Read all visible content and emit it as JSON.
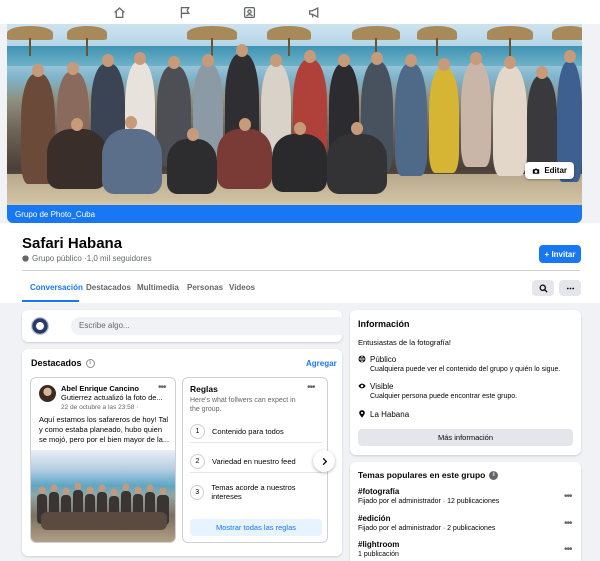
{
  "topnav": {
    "icons": [
      "home-icon",
      "flag-icon",
      "gallery-icon",
      "megaphone-icon"
    ]
  },
  "cover": {
    "edit_label": "Editar",
    "group_link": "Grupo de Photo_Cuba"
  },
  "header": {
    "title": "Safari Habana",
    "subtitle": "Grupo público ·1,0 mil seguidores",
    "invite_label": "+ Invitar",
    "tabs": [
      "Conversación",
      "Destacados",
      "Multimedia",
      "Personas",
      "Videos"
    ]
  },
  "composer": {
    "placeholder": "Escribe algo..."
  },
  "destacados": {
    "title": "Destacados",
    "add_label": "Agregar",
    "post": {
      "author": "Abel Enrique Cancino",
      "author_rest": "Gutierrez actualizó la foto de...",
      "date": "22 de octubre a las 23:58 ·",
      "text": "Aquí estamos los safareros de hoy! Tal y como estaba planeado, hubo quien se mojó, pero por el bien mayor de la..."
    },
    "rules": {
      "title": "Reglas",
      "subtitle": "Here's what follwers can expect in the group.",
      "items": [
        {
          "num": "1",
          "label": "Contenido para todos"
        },
        {
          "num": "2",
          "label": "Variedad en nuestro feed"
        },
        {
          "num": "3",
          "label": "Temas acorde a nuestros intereses"
        }
      ],
      "button": "Mostrar todas las reglas"
    }
  },
  "info": {
    "title": "Información",
    "description": "Entusiastas de la fotografía!",
    "public_label": "Público",
    "public_sub": "Cualquiera puede ver el contenido del grupo y quién lo sigue.",
    "visible_label": "Visible",
    "visible_sub": "Cualquier persona puede encontrar este grupo.",
    "location": "La Habana",
    "more_button": "Más información"
  },
  "temas": {
    "title": "Temas populares en este grupo",
    "items": [
      {
        "name": "#fotografía",
        "meta": "Fijado por el administrador · 12 publicaciones"
      },
      {
        "name": "#edición",
        "meta": "Fijado por el administrador · 2 publicaciones"
      },
      {
        "name": "#lightroom",
        "meta": "1 publicación"
      }
    ]
  },
  "colors": {
    "accent": "#1877f2",
    "background": "#f0f2f5",
    "text_secondary": "#65676b"
  }
}
